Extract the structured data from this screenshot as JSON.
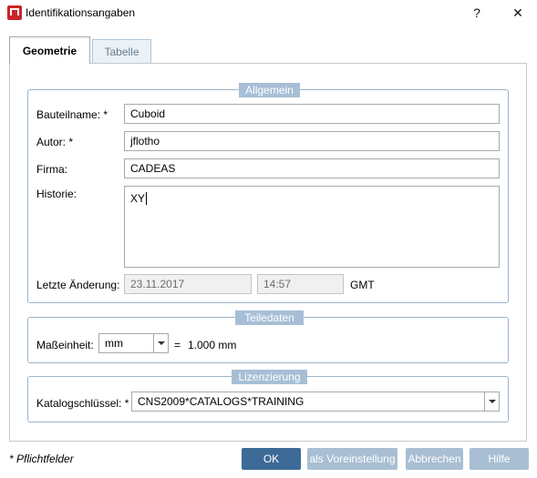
{
  "window": {
    "title": "Identifikationsangaben",
    "help_glyph": "?",
    "close_glyph": "✕"
  },
  "tabs": [
    {
      "label": "Geometrie",
      "active": true
    },
    {
      "label": "Tabelle",
      "active": false
    }
  ],
  "allgemein": {
    "legend": "Allgemein",
    "bauteilname_label": "Bauteilname: *",
    "bauteilname_value": "Cuboid",
    "autor_label": "Autor: *",
    "autor_value": "jflotho",
    "firma_label": "Firma:",
    "firma_value": "CADEAS",
    "historie_label": "Historie:",
    "historie_value": "XY",
    "letzte_label": "Letzte Änderung:",
    "date_value": "23.11.2017",
    "time_value": "14:57",
    "tz_label": "GMT"
  },
  "teiledaten": {
    "legend": "Teiledaten",
    "masseinheit_label": "Maßeinheit:",
    "unit_value": "mm",
    "equals": "=",
    "conversion": "1.000 mm"
  },
  "lizenzierung": {
    "legend": "Lizenzierung",
    "katalog_label": "Katalogschlüssel: *",
    "katalog_value": "CNS2009*CATALOGS*TRAINING"
  },
  "footer": {
    "note": "* Pflichtfelder",
    "ok": "OK",
    "default": "als Voreinstellung",
    "cancel": "Abbrechen",
    "help": "Hilfe"
  },
  "colors": {
    "primary_button": "#3d6a96",
    "disabled_button": "#a8bed3",
    "legend_bg": "#a7bfd6",
    "app_icon": "#c8262a"
  }
}
